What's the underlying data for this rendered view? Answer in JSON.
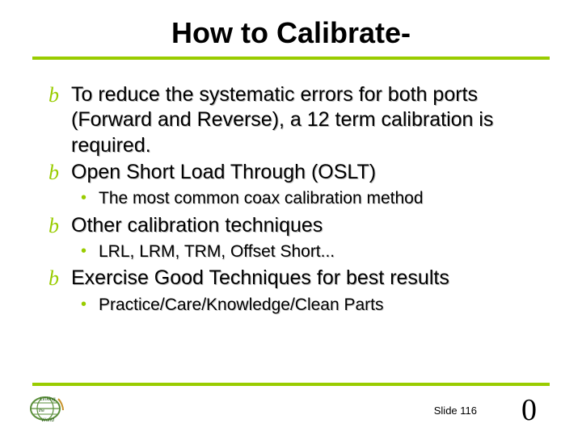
{
  "title": "How to Calibrate-",
  "bullets": [
    {
      "text": "To reduce the systematic errors for both ports (Forward and Reverse), a 12 term calibration is required.",
      "subs": []
    },
    {
      "text": "Open Short Load Through (OSLT)",
      "subs": [
        "The most common coax calibration method"
      ]
    },
    {
      "text": "Other calibration techniques",
      "subs": [
        "LRL, LRM, TRM, Offset Short..."
      ]
    },
    {
      "text": "Exercise Good Techniques for best results",
      "subs": [
        "Practice/Care/Knowledge/Clean Parts"
      ]
    }
  ],
  "slide_label": "Slide 116",
  "page_corner": "0",
  "bullet_glyph": "b",
  "dot_glyph": "•"
}
